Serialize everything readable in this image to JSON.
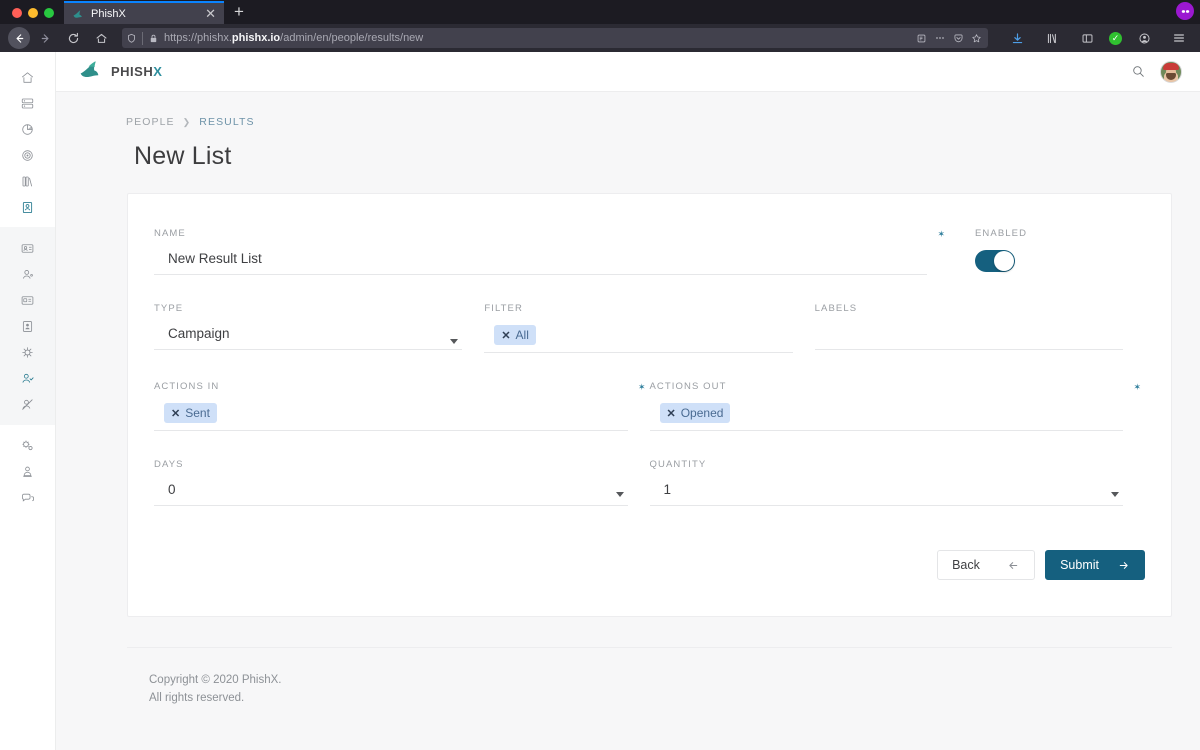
{
  "browser": {
    "tab": {
      "title": "PhishX",
      "favicon": "phishx-fish-icon",
      "close": "✕"
    },
    "new_tab": "+",
    "url_prefix": "https://phishx.",
    "url_bold": "phishx.io",
    "url_suffix": "/admin/en/people/results/new",
    "icons": {
      "back": "back-arrow-icon",
      "forward": "forward-arrow-icon",
      "reload": "reload-icon",
      "home": "home-icon",
      "shield": "tracking-protection-icon",
      "lock": "padlock-icon",
      "reader": "reader-view-icon",
      "page_actions": "ellipsis-icon",
      "pocket": "pocket-icon",
      "bookmark": "star-icon",
      "downloads": "download-icon",
      "library": "library-icon",
      "sidebar": "sidebar-icon",
      "status_ok": "green-check-icon",
      "account": "account-icon",
      "menu": "hamburger-menu-icon",
      "extension": "extension-badge-icon"
    }
  },
  "sidebar": {
    "groups": [
      {
        "items": [
          {
            "name": "home",
            "icon": "home-icon",
            "active": false
          },
          {
            "name": "dashboard",
            "icon": "server-icon",
            "active": false
          },
          {
            "name": "analytics",
            "icon": "pie-chart-icon",
            "active": false
          },
          {
            "name": "campaigns",
            "icon": "target-icon",
            "active": false
          },
          {
            "name": "library",
            "icon": "books-icon",
            "active": false
          },
          {
            "name": "results",
            "icon": "id-card-icon",
            "active": true
          }
        ]
      },
      {
        "items": [
          {
            "name": "people-list",
            "icon": "id-badge-icon",
            "active": false
          },
          {
            "name": "person",
            "icon": "user-icon",
            "active": false
          },
          {
            "name": "registry",
            "icon": "contact-card-icon",
            "active": false
          },
          {
            "name": "profiles",
            "icon": "user-card-icon",
            "active": false
          },
          {
            "name": "threats",
            "icon": "spider-icon",
            "active": false
          },
          {
            "name": "approved-users",
            "icon": "user-check-icon",
            "active": true
          },
          {
            "name": "blocked-users",
            "icon": "user-blocked-icon",
            "active": false
          }
        ]
      },
      {
        "items": [
          {
            "name": "settings",
            "icon": "gears-icon",
            "active": false
          },
          {
            "name": "admin",
            "icon": "user-shield-icon",
            "active": false
          },
          {
            "name": "messages",
            "icon": "chat-icon",
            "active": false
          }
        ]
      }
    ]
  },
  "header": {
    "brand_word_main": "PHISH",
    "brand_word_accent": "X",
    "brand_logo": "phishx-shark-logo",
    "search_icon": "search-icon",
    "avatar": "user-avatar"
  },
  "breadcrumb": {
    "parent": "PEOPLE",
    "separator": "❯",
    "current": "RESULTS"
  },
  "page": {
    "title": "New List"
  },
  "form": {
    "name": {
      "label": "NAME",
      "value": "New Result List",
      "required_marker": "✶"
    },
    "enabled": {
      "label": "ENABLED",
      "state": "on"
    },
    "type": {
      "label": "TYPE",
      "value": "Campaign",
      "caret": "dropdown-caret"
    },
    "filter": {
      "label": "FILTER",
      "chips": [
        {
          "remove": "✕",
          "label": "All"
        }
      ]
    },
    "labels": {
      "label": "LABELS",
      "value": ""
    },
    "actions_in": {
      "label": "ACTIONS IN",
      "required_marker": "✶",
      "chips": [
        {
          "remove": "✕",
          "label": "Sent"
        }
      ]
    },
    "actions_out": {
      "label": "ACTIONS OUT",
      "required_marker": "✶",
      "chips": [
        {
          "remove": "✕",
          "label": "Opened"
        }
      ]
    },
    "days": {
      "label": "DAYS",
      "value": "0",
      "caret": "dropdown-caret"
    },
    "quantity": {
      "label": "QUANTITY",
      "value": "1",
      "caret": "dropdown-caret"
    }
  },
  "buttons": {
    "back": {
      "label": "Back",
      "icon": "arrow-left-icon"
    },
    "submit": {
      "label": "Submit",
      "icon": "arrow-right-icon"
    }
  },
  "footer": {
    "line1": "Copyright © 2020 PhishX.",
    "line2": "All rights reserved."
  },
  "colors": {
    "accent": "#15607f",
    "accent_light": "#2e8f9e",
    "chip_bg": "#cfe0f8",
    "chip_text": "#4a6b92",
    "breadcrumb_current": "#6e93a8"
  }
}
